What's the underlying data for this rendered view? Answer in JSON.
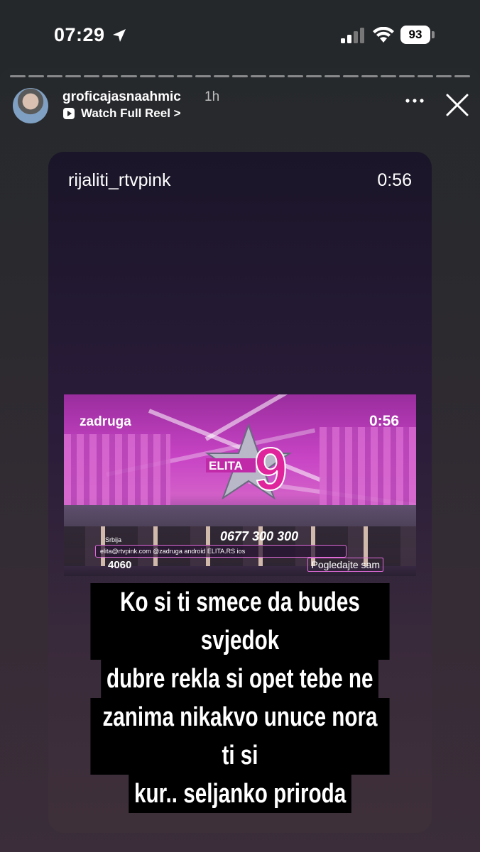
{
  "status_bar": {
    "time": "07:29",
    "battery": "93"
  },
  "story": {
    "author": {
      "username": "groficajasnaahmic",
      "age": "1h",
      "reel_link": "Watch Full Reel >"
    },
    "progress_segments": 25,
    "card": {
      "username": "rijaliti_rtvpink",
      "duration": "0:56",
      "video": {
        "channel": "zadruga",
        "timer": "0:56",
        "logo_text": "ELITA 9",
        "phone": "0677 300 300",
        "region": "Srbija",
        "info": "elita@rtvpink.com   @zadruga   android ELITA.RS ios",
        "count": "4060",
        "sign": "Pogledajte sam"
      },
      "caption_lines": [
        "Ko si ti smece da budes svjedok",
        "dubre rekla si opet tebe ne",
        "zanima nikakvo unuce nora ti si",
        "kur.. seljanko priroda"
      ]
    }
  },
  "colors": {
    "background": "#25282b",
    "accent_pink": "#c844c5"
  },
  "icons": [
    "location-arrow-icon",
    "signal-icon",
    "wifi-icon",
    "battery-icon",
    "reel-play-icon",
    "more-icon",
    "close-icon"
  ]
}
